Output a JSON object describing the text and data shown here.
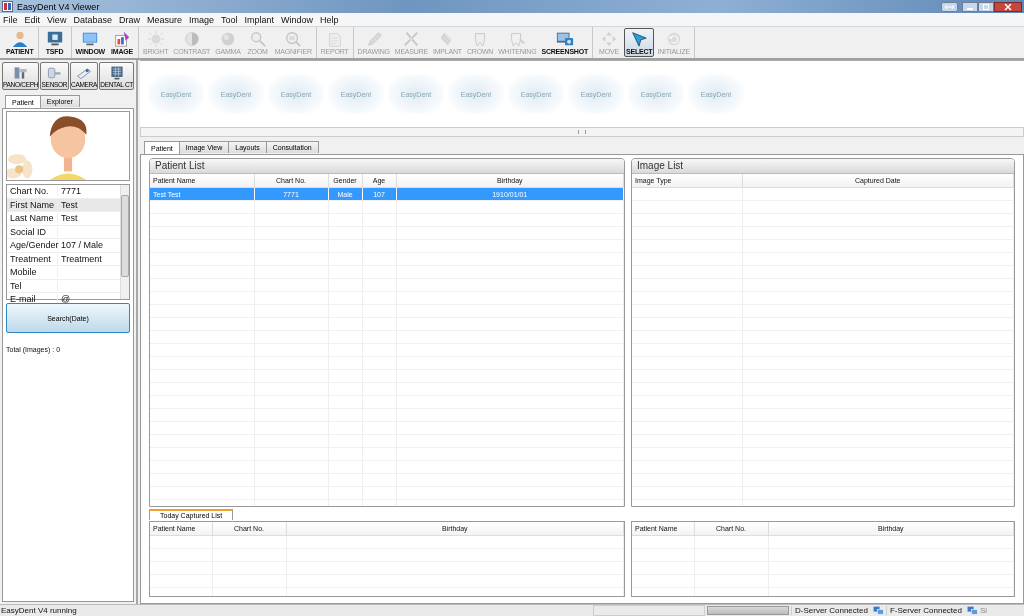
{
  "window": {
    "title": "EasyDent V4 Viewer"
  },
  "menu": [
    "File",
    "Edit",
    "View",
    "Database",
    "Draw",
    "Measure",
    "Image",
    "Tool",
    "Implant",
    "Window",
    "Help"
  ],
  "toolbar": [
    [
      {
        "label": "PATIENT",
        "disabled": false,
        "selected": false
      }
    ],
    [
      {
        "label": "TSFD",
        "disabled": false,
        "selected": false
      }
    ],
    [
      {
        "label": "WINDOW",
        "disabled": false,
        "selected": false
      },
      {
        "label": "IMAGE",
        "disabled": false,
        "selected": false
      }
    ],
    [
      {
        "label": "BRIGHT",
        "disabled": true,
        "selected": false
      },
      {
        "label": "CONTRAST",
        "disabled": true,
        "selected": false
      },
      {
        "label": "GAMMA",
        "disabled": true,
        "selected": false
      },
      {
        "label": "ZOOM",
        "disabled": true,
        "selected": false
      },
      {
        "label": "MAGNIFIER",
        "disabled": true,
        "selected": false
      }
    ],
    [
      {
        "label": "REPORT",
        "disabled": true,
        "selected": false
      }
    ],
    [
      {
        "label": "DRAWING",
        "disabled": true,
        "selected": false
      },
      {
        "label": "MEASURE",
        "disabled": true,
        "selected": false
      },
      {
        "label": "IMPLANT",
        "disabled": true,
        "selected": false
      },
      {
        "label": "CROWN",
        "disabled": true,
        "selected": false
      },
      {
        "label": "WHITENING",
        "disabled": true,
        "selected": false
      },
      {
        "label": "SCREENSHOT",
        "disabled": false,
        "selected": false
      }
    ],
    [
      {
        "label": "MOVE",
        "disabled": true,
        "selected": false
      },
      {
        "label": "SELECT",
        "disabled": false,
        "selected": true
      },
      {
        "label": "INITIALIZE",
        "disabled": true,
        "selected": false
      }
    ]
  ],
  "devices": [
    "PANO/CEPH",
    "SENSOR",
    "CAMERA",
    "DENTAL CT"
  ],
  "side_tabs": [
    {
      "label": "Patient",
      "selected": true
    },
    {
      "label": "Explorer",
      "selected": false
    }
  ],
  "patient_info": [
    {
      "label": "Chart No.",
      "value": "7771",
      "selected": false
    },
    {
      "label": "First Name",
      "value": "Test",
      "selected": true
    },
    {
      "label": "Last Name",
      "value": "Test",
      "selected": false
    },
    {
      "label": "Social ID",
      "selected": false
    },
    {
      "label": "Age/Gender",
      "value": "107 / Male",
      "selected": false
    },
    {
      "label": "Treatment",
      "value": "Treatment",
      "selected": false
    },
    {
      "label": "Mobile",
      "selected": false
    },
    {
      "label": "Tel",
      "selected": false
    },
    {
      "label": "E-mail",
      "value": "@",
      "selected": false
    }
  ],
  "search_button": "Search(Date)",
  "total_images": "Total (Images) : 0",
  "thumbnails": [
    "EasyDent",
    "EasyDent",
    "EasyDent",
    "EasyDent",
    "EasyDent",
    "EasyDent",
    "EasyDent",
    "EasyDent",
    "EasyDent",
    "EasyDent"
  ],
  "main_tabs": [
    {
      "label": "Patient",
      "selected": true
    },
    {
      "label": "Image View",
      "selected": false
    },
    {
      "label": "Layouts",
      "selected": false
    },
    {
      "label": "Consultation",
      "selected": false
    }
  ],
  "patient_list": {
    "title": "Patient List",
    "columns": [
      "Patient Name",
      "Chart No.",
      "Gender",
      "Age",
      "Birthday"
    ],
    "rows": [
      {
        "cells": [
          "Test Test",
          "7771",
          "Male",
          "107",
          "1910/01/01"
        ],
        "selected": true
      }
    ]
  },
  "image_list": {
    "title": "Image List",
    "columns": [
      "Image Type",
      "Captured Date"
    ]
  },
  "bottom_tabs": [
    {
      "label": "Today Captured List",
      "selected": true
    }
  ],
  "today_list": {
    "columns": [
      "Patient Name",
      "Chart No.",
      "Birthday"
    ]
  },
  "today_list_right": {
    "columns": [
      "Patient Name",
      "Chart No.",
      "Birthday"
    ]
  },
  "status_bar": {
    "message": "EasyDent V4 running",
    "progress": {
      "level": 0
    },
    "d_server": "D-Server Connected",
    "f_server": "F-Server Connected",
    "extra": "Si"
  }
}
